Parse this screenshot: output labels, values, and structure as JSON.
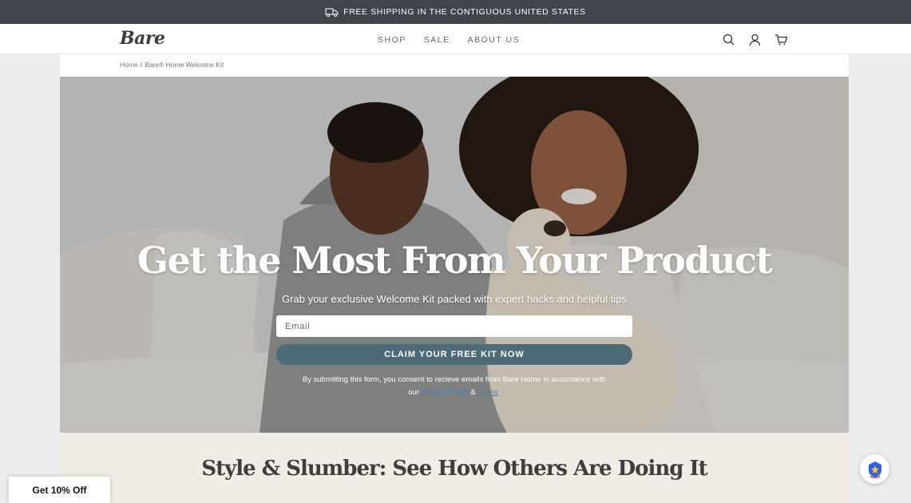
{
  "announcement": {
    "text": "FREE SHIPPING IN THE CONTIGUOUS UNITED STATES",
    "icon": "truck-icon"
  },
  "header": {
    "logo": "Bare",
    "nav": [
      "SHOP",
      "SALE",
      "ABOUT US"
    ],
    "icons": [
      "search-icon",
      "account-icon",
      "cart-icon"
    ]
  },
  "breadcrumb": {
    "home": "Home",
    "separator": "/",
    "current": "Bare® Home Welcome Kit"
  },
  "hero": {
    "headline": "Get the Most From Your Product",
    "subline": "Grab your exclusive Welcome Kit packed with expert hacks and helpful tips",
    "email_placeholder": "Email",
    "cta": "CLAIM YOUR FREE KIT NOW",
    "consent_line1": "By submitting this form, you consent to recieve emails from Bare Home in accordance with",
    "consent_prefix": "our",
    "privacy_link": "Privacy Policy",
    "amp": "&",
    "terms_link": "Terms",
    "period": "."
  },
  "section": {
    "title": "Style & Slumber: See How Others Are Doing It"
  },
  "popup": {
    "discount": "Get 10% Off"
  },
  "colors": {
    "topbar": "#41444b",
    "cta": "#4c6a78",
    "section_bg": "#f1ece6",
    "link": "#4f7ec8"
  }
}
